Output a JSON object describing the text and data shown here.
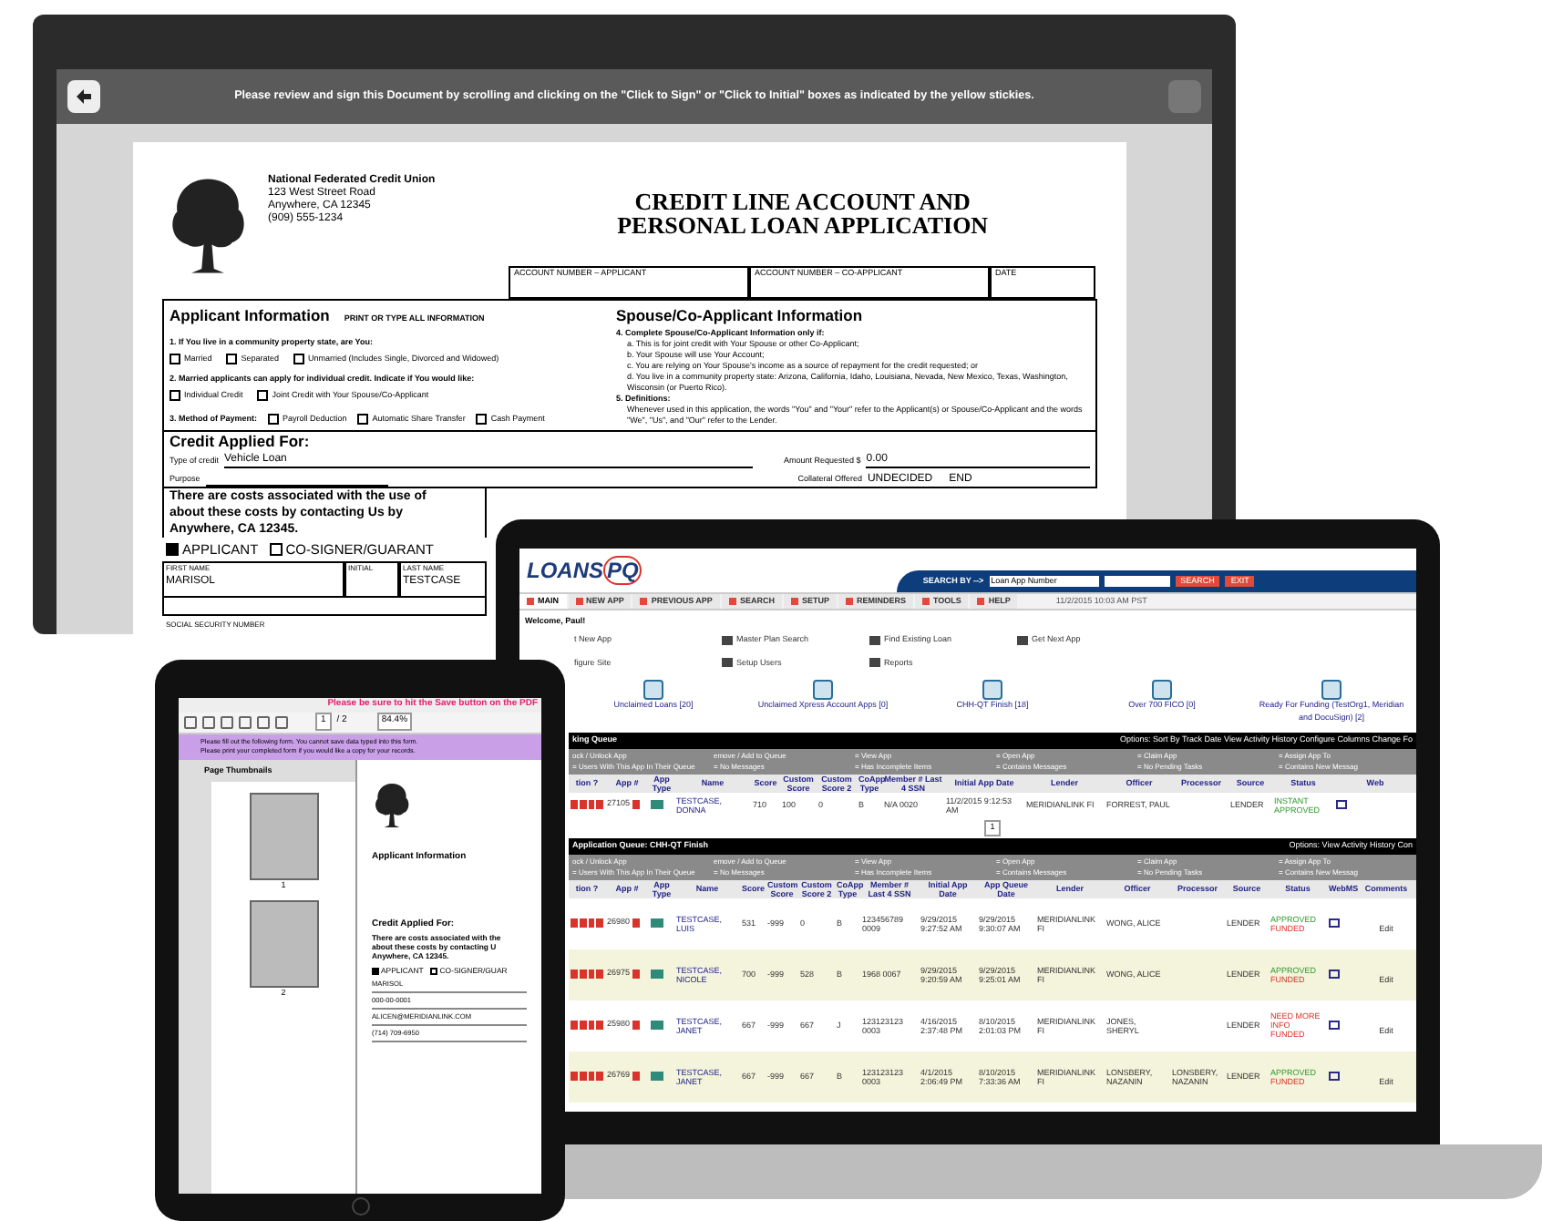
{
  "monitor": {
    "message": "Please review and sign this Document by scrolling and clicking on the \"Click to Sign\" or \"Click to Initial\" boxes as indicated by the yellow stickies.",
    "document": {
      "org_lines": [
        "National Federated Credit Union",
        "123 West Street Road",
        "Anywhere, CA 12345",
        "(909) 555-1234"
      ],
      "title_lines": [
        "CREDIT LINE ACCOUNT AND",
        "PERSONAL LOAN APPLICATION"
      ],
      "account_fields": [
        "ACCOUNT NUMBER – APPLICANT",
        "ACCOUNT NUMBER – CO-APPLICANT",
        "DATE"
      ],
      "applicant": {
        "heading": "Applicant Information",
        "note": "PRINT OR TYPE ALL INFORMATION",
        "questions": [
          {
            "kind": "block",
            "text": "1. If You live in a community property state, are You:",
            "options": [
              {
                "label": "Married",
                "checked": false
              },
              {
                "label": "Separated",
                "checked": false
              },
              {
                "label": "Unmarried (Includes Single, Divorced and Widowed)",
                "checked": false
              }
            ]
          },
          {
            "kind": "block",
            "text": "2. Married applicants can apply for individual credit. Indicate if You would like:",
            "options": [
              {
                "label": "Individual Credit",
                "checked": false
              },
              {
                "label": "Joint Credit with Your Spouse/Co-Applicant",
                "checked": false
              }
            ]
          },
          {
            "kind": "inline",
            "text": "3. Method of Payment:",
            "options": [
              {
                "label": "Payroll Deduction",
                "checked": false
              },
              {
                "label": "Automatic Share Transfer",
                "checked": false
              },
              {
                "label": "Cash Payment",
                "checked": false
              }
            ]
          }
        ]
      },
      "spouse": {
        "heading": "Spouse/Co-Applicant Information",
        "items": [
          {
            "text": "4. Complete Spouse/Co-Applicant Information only if:",
            "children": [
              {
                "text": "a. This is for joint credit with Your Spouse or other Co-Applicant;"
              },
              {
                "text": "b. Your Spouse will use Your Account;"
              },
              {
                "text": "c. You are relying on Your Spouse's income as a source of repayment for the credit requested; or"
              },
              {
                "text": "d. You live in a community property state: Arizona, California, Idaho, Louisiana, Nevada, New Mexico, Texas, Washington, Wisconsin (or Puerto Rico)."
              }
            ]
          },
          {
            "text": "5. Definitions:",
            "children": [
              {
                "text": "Whenever used in this application, the words \"You\" and \"Your\" refer to the Applicant(s) or Spouse/Co-Applicant and the words \"We\", \"Us\", and \"Our\" refer to the Lender."
              }
            ]
          }
        ]
      },
      "credit": {
        "heading": "Credit Applied For:",
        "type_label": "Type of credit",
        "type_value": "Vehicle Loan",
        "amount_label": "Amount Requested $",
        "amount_value": "0.00",
        "purpose_label": "Purpose",
        "collateral_label": "Collateral Offered",
        "collateral_value": "UNDECIDED",
        "collateral_end": "END"
      },
      "costs_lines": [
        "There are costs associated with the use of",
        "about these costs by contacting Us by",
        "Anywhere, CA 12345."
      ],
      "roles": [
        {
          "label": "APPLICANT",
          "checked": true
        },
        {
          "label": "CO-SIGNER/GUARANT",
          "checked": false
        }
      ],
      "name_fields": [
        {
          "label": "FIRST NAME",
          "value": "MARISOL"
        },
        {
          "label": "INITIAL"
        },
        {
          "label": "LAST NAME",
          "value": "TESTCASE"
        }
      ],
      "ssn_label": "SOCIAL SECURITY NUMBER"
    }
  },
  "laptop": {
    "logo": {
      "main": "LOANS",
      "accent": "PQ"
    },
    "search_label": "SEARCH BY -->",
    "search_select": "Loan App Number",
    "search_buttons": [
      "SEARCH",
      "EXIT"
    ],
    "nav": [
      {
        "label": "MAIN",
        "selected": true
      },
      {
        "label": "NEW APP",
        "selected": false
      },
      {
        "label": "PREVIOUS APP",
        "selected": false
      },
      {
        "label": "SEARCH",
        "selected": false
      },
      {
        "label": "SETUP",
        "selected": false
      },
      {
        "label": "REMINDERS",
        "selected": false
      },
      {
        "label": "TOOLS",
        "selected": false
      },
      {
        "label": "HELP",
        "selected": false
      }
    ],
    "timestamp": "11/2/2015 10:03 AM PST",
    "welcome": "Welcome, Paul!",
    "quick_links": [
      "t New App",
      "Master Plan Search",
      "Find Existing Loan",
      "Get Next App",
      "figure Site",
      "Setup Users",
      "Reports"
    ],
    "tiles": [
      "Unclaimed Loans [20]",
      "Unclaimed Xpress Account Apps [0]",
      "CHH-QT Finish [18]",
      "Over 700 FICO [0]",
      "Ready For Funding (TestOrg1, Meridian and DocuSign) [2]"
    ],
    "queues": [
      {
        "title": "king Queue",
        "options": "Options: Sort By Track Date View Activity History Configure Columns Change Fo",
        "legend": [
          "ock / Unlock App",
          "emove / Add to Queue",
          "= View App",
          "= Open App",
          "= Claim App",
          "= Assign App To",
          "= Users With This App In Their Queue",
          "= No Messages",
          "= Has Incomplete Items",
          "= Contains Messages",
          "= No Pending Tasks",
          "= Contains New Messag"
        ],
        "lead_columns": [
          "tion ?",
          "App #",
          "App Type"
        ],
        "columns": [
          "Name",
          "Score",
          "Custom Score",
          "Custom Score 2",
          "CoApp Type",
          "Member # Last 4 SSN",
          "Initial App Date",
          "Lender",
          "Officer",
          "Processor",
          "Source"
        ],
        "tail_columns": [
          "Status",
          "Web"
        ],
        "rows": [
          {
            "app": "27105",
            "cells": [
              "TESTCASE, DONNA",
              "710",
              "100",
              "0",
              "B",
              "N/A 0020",
              "11/2/2015 9:12:53 AM",
              "MERIDIANLINK FI",
              "FORREST, PAUL",
              null,
              "LENDER"
            ],
            "status": [
              {
                "text": "INSTANT APPROVED",
                "kind": "positive"
              }
            ]
          }
        ],
        "pages": [
          "1"
        ]
      },
      {
        "title": "Application Queue: CHH-QT Finish",
        "options": "Options: View Activity History Con",
        "legend": [
          "ock / Unlock App",
          "emove / Add to Queue",
          "= View App",
          "= Open App",
          "= Claim App",
          "= Assign App To",
          "= Users With This App In Their Queue",
          "= No Messages",
          "= Has Incomplete Items",
          "= Contains Messages",
          "= No Pending Tasks",
          "= Contains New Messag"
        ],
        "lead_columns": [
          "tion ?",
          "App #",
          "App Type"
        ],
        "columns": [
          "Name",
          "Score",
          "Custom Score",
          "Custom Score 2",
          "CoApp Type",
          "Member # Last 4 SSN",
          "Initial App Date",
          "App Queue Date",
          "Lender",
          "Officer",
          "Processor",
          "Source"
        ],
        "tail_columns": [
          "Status",
          "WebMS",
          "Comments"
        ],
        "rows": [
          {
            "app": "26980",
            "cells": [
              "TESTCASE, LUIS",
              "531",
              "-999",
              "0",
              "B",
              "123456789 0009",
              "9/29/2015 9:27:52 AM",
              "9/29/2015 9:30:07 AM",
              "MERIDIANLINK FI",
              "WONG, ALICE",
              null,
              "LENDER"
            ],
            "status": [
              {
                "text": "APPROVED",
                "kind": "positive"
              },
              {
                "text": "FUNDED",
                "kind": "negative"
              }
            ],
            "comment": "Edit"
          },
          {
            "app": "26975",
            "cells": [
              "TESTCASE, NICOLE",
              "700",
              "-999",
              "528",
              "B",
              "1968 0067",
              "9/29/2015 9:20:59 AM",
              "9/29/2015 9:25:01 AM",
              "MERIDIANLINK FI",
              "WONG, ALICE",
              null,
              "LENDER"
            ],
            "status": [
              {
                "text": "APPROVED",
                "kind": "positive"
              },
              {
                "text": "FUNDED",
                "kind": "negative"
              }
            ],
            "comment": "Edit"
          },
          {
            "app": "25980",
            "cells": [
              "TESTCASE, JANET",
              "667",
              "-999",
              "667",
              "J",
              "123123123 0003",
              "4/16/2015 2:37:48 PM",
              "8/10/2015 2:01:03 PM",
              "MERIDIANLINK FI",
              "JONES, SHERYL",
              null,
              "LENDER"
            ],
            "status": [
              {
                "text": "NEED MORE INFO",
                "kind": "negative"
              },
              {
                "text": "FUNDED",
                "kind": "negative"
              }
            ],
            "comment": "Edit"
          },
          {
            "app": "26769",
            "cells": [
              "TESTCASE, JANET",
              "667",
              "-999",
              "667",
              "B",
              "123123123 0003",
              "4/1/2015 2:06:49 PM",
              "8/10/2015 7:33:36 AM",
              "MERIDIANLINK FI",
              "LONSBERY, NAZANIN",
              "LONSBERY, NAZANIN",
              "LENDER"
            ],
            "status": [
              {
                "text": "APPROVED",
                "kind": "positive"
              },
              {
                "text": "FUNDED",
                "kind": "negative"
              }
            ],
            "comment": "Edit"
          }
        ]
      }
    ]
  },
  "tablet": {
    "notice": "Please be sure to hit the Save button on the PDF",
    "page": "1",
    "page_total": "/ 2",
    "zoom": "84.4%",
    "banner_lines": [
      "Please fill out the following form. You cannot save data typed into this form.",
      "Please print your completed form if you would like a copy for your records."
    ],
    "thumbnails_title": "Page Thumbnails",
    "thumbnails": [
      "1",
      "2"
    ],
    "doc": {
      "headings": [
        "Applicant Information",
        "Credit Applied For:"
      ],
      "costs_lines": [
        "There are costs associated with the",
        "about these costs by contacting U",
        "Anywhere, CA 12345."
      ],
      "roles": [
        {
          "label": "APPLICANT",
          "checked": true
        },
        {
          "label": "CO-SIGNER/GUAR",
          "checked": false
        }
      ],
      "values": [
        "MARISOL",
        "000-00-0001",
        "ALICEN@MERIDIANLINK.COM",
        "(714) 709-6950"
      ]
    }
  }
}
